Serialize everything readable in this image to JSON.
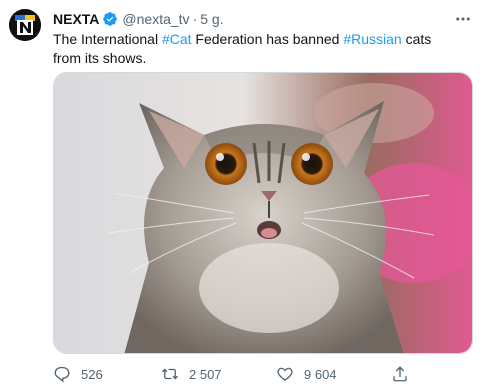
{
  "author": {
    "name": "NEXTA",
    "handle": "@nexta_tv",
    "separator": "·",
    "time": "5 g.",
    "verified": true,
    "avatar_icon": "nexta-logo"
  },
  "tweet": {
    "text_parts": [
      "The International ",
      "#Cat",
      " Federation has banned ",
      "#Russian",
      " cats from its shows."
    ],
    "hashtag_color": "#1d9bf0"
  },
  "media": {
    "icon": "startled-cat-photo"
  },
  "actions": {
    "reply_count": "526",
    "retweet_count": "2 507",
    "like_count": "9 604"
  },
  "icons": {
    "reply": "reply-icon",
    "retweet": "retweet-icon",
    "like": "heart-icon",
    "share": "share-icon",
    "more": "more-icon",
    "verified": "verified-badge-icon"
  }
}
